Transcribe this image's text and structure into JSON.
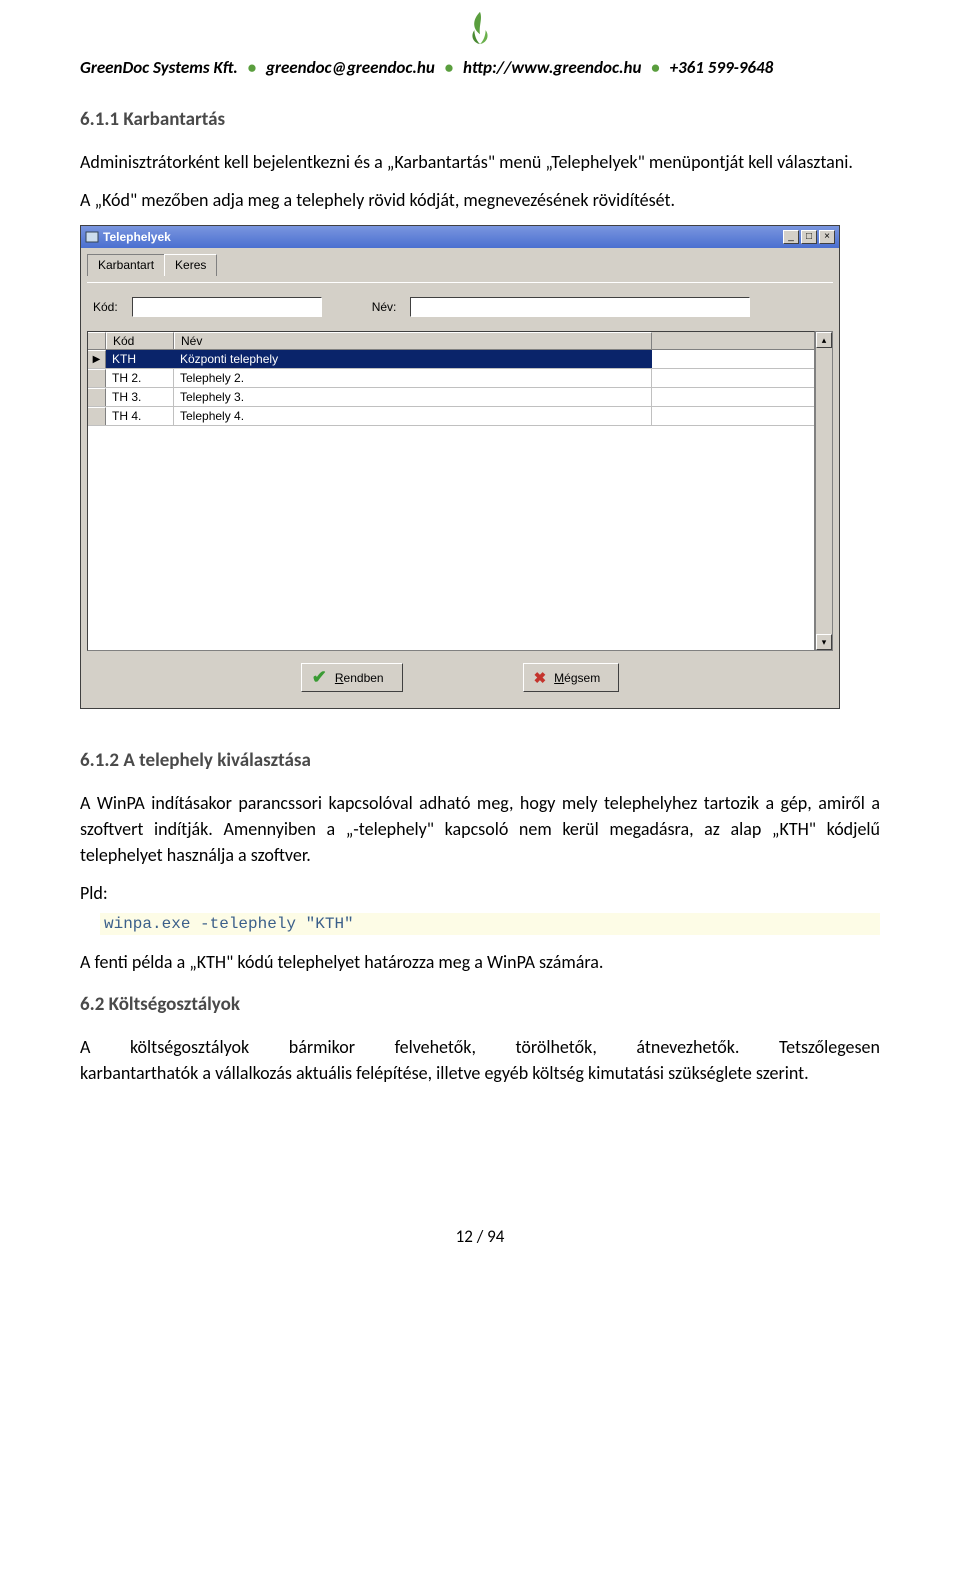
{
  "header": {
    "company": "GreenDoc Systems Kft.",
    "email": "greendoc@greendoc.hu",
    "url": "http://www.greendoc.hu",
    "phone": "+361 599-9648"
  },
  "section611": {
    "number_title": "6.1.1 Karbantartás",
    "para1": "Adminisztrátorként kell bejelentkezni és a „Karbantartás\" menü „Telephelyek\" menüpontját kell választani.",
    "para2": "A „Kód\" mezőben adja meg a telephely rövid kódját, megnevezésének rövidítését."
  },
  "screenshot": {
    "title": "Telephelyek",
    "tabs": {
      "karbantart": "Karbantart",
      "keres": "Keres"
    },
    "labels": {
      "kod": "Kód:",
      "nev": "Név:"
    },
    "inputs": {
      "kod_value": "",
      "nev_value": ""
    },
    "grid": {
      "headers": {
        "kod": "Kód",
        "nev": "Név"
      },
      "rows": [
        {
          "kod": "KTH",
          "nev": "Központi telephely",
          "selected": true,
          "marker": "▶"
        },
        {
          "kod": "TH 2.",
          "nev": "Telephely 2.",
          "selected": false,
          "marker": ""
        },
        {
          "kod": "TH 3.",
          "nev": "Telephely 3.",
          "selected": false,
          "marker": ""
        },
        {
          "kod": "TH 4.",
          "nev": "Telephely 4.",
          "selected": false,
          "marker": ""
        }
      ]
    },
    "buttons": {
      "ok_prefix": "R",
      "ok_rest": "endben",
      "cancel_prefix": "M",
      "cancel_rest": "égsem"
    }
  },
  "section612": {
    "number_title": "6.1.2 A telephely kiválasztása",
    "para1": "A WinPA indításakor parancssori kapcsolóval adható meg, hogy mely telephelyhez tartozik a gép, amiről a szoftvert indítják. Amennyiben a „-telephely\" kapcsoló nem kerül megadásra, az alap „KTH\" kódjelű telephelyet használja a szoftver.",
    "pld_label": "Pld:",
    "code": "winpa.exe -telephely \"KTH\"",
    "para2": "A fenti példa a „KTH\" kódú telephelyet határozza meg a WinPA számára."
  },
  "section62": {
    "number_title": "6.2  Költségosztályok",
    "para_words": [
      "A",
      "költségosztályok",
      "bármikor",
      "felvehetők,",
      "törölhetők,",
      "átnevezhetők.",
      "Tetszőlegesen"
    ],
    "para_rest": "karbantarthatók a vállalkozás aktuális felépítése, illetve egyéb költség kimutatási szükséglete szerint."
  },
  "footer": {
    "page": "12 / 94"
  }
}
